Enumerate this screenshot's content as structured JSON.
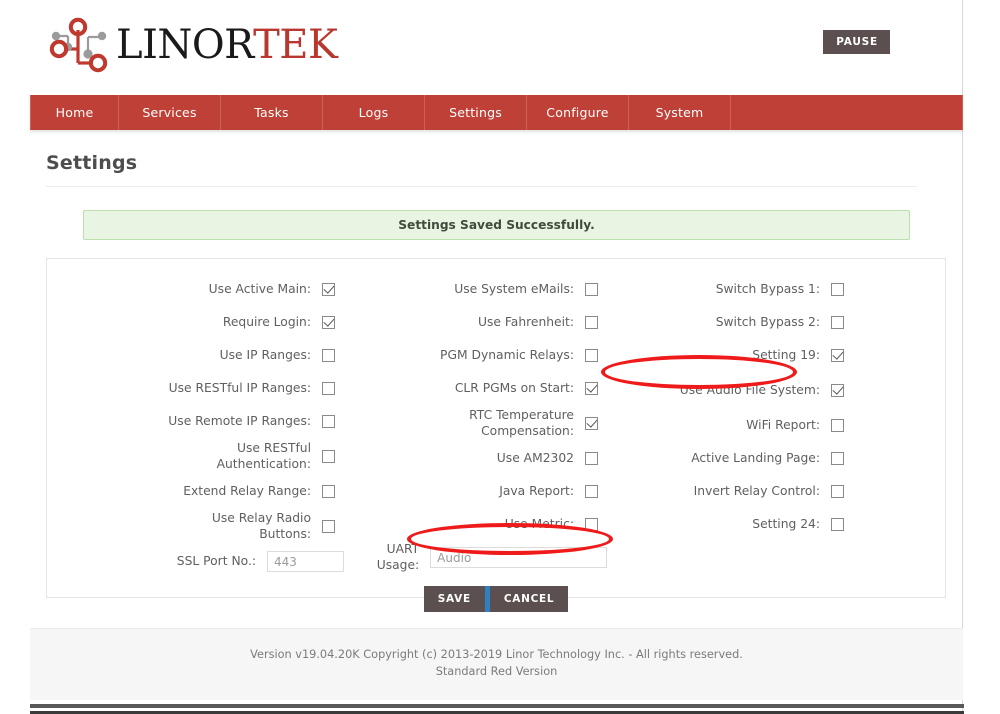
{
  "brand": {
    "name_part1": "LINOR",
    "name_part2": "TEK",
    "logo_icon": "circuit-node-logo",
    "accent_color": "#b8372f"
  },
  "header": {
    "pause_button": "PAUSE"
  },
  "nav": {
    "items": [
      {
        "label": "Home"
      },
      {
        "label": "Services"
      },
      {
        "label": "Tasks"
      },
      {
        "label": "Logs"
      },
      {
        "label": "Settings"
      },
      {
        "label": "Configure"
      },
      {
        "label": "System"
      }
    ]
  },
  "page": {
    "title": "Settings",
    "alert": "Settings Saved Successfully."
  },
  "settings": {
    "column1": [
      {
        "label": "Use Active Main:",
        "type": "checkbox",
        "checked": true
      },
      {
        "label": "Require Login:",
        "type": "checkbox",
        "checked": true
      },
      {
        "label": "Use IP Ranges:",
        "type": "checkbox",
        "checked": false
      },
      {
        "label": "Use RESTful IP Ranges:",
        "type": "checkbox",
        "checked": false
      },
      {
        "label": "Use Remote IP Ranges:",
        "type": "checkbox",
        "checked": false
      },
      {
        "label": "Use RESTful\nAuthentication:",
        "type": "checkbox",
        "checked": false
      },
      {
        "label": "Extend Relay Range:",
        "type": "checkbox",
        "checked": false
      },
      {
        "label": "Use Relay Radio\nButtons:",
        "type": "checkbox",
        "checked": false
      },
      {
        "label": "SSL Port No.:",
        "type": "text",
        "value": "443"
      }
    ],
    "column2": [
      {
        "label": "Use System eMails:",
        "type": "checkbox",
        "checked": false
      },
      {
        "label": "Use Fahrenheit:",
        "type": "checkbox",
        "checked": false
      },
      {
        "label": "PGM Dynamic Relays:",
        "type": "checkbox",
        "checked": false
      },
      {
        "label": "CLR PGMs on Start:",
        "type": "checkbox",
        "checked": true
      },
      {
        "label": "RTC Temperature\nCompensation:",
        "type": "checkbox",
        "checked": true
      },
      {
        "label": "Use AM2302",
        "type": "checkbox",
        "checked": false
      },
      {
        "label": "Java Report:",
        "type": "checkbox",
        "checked": false
      },
      {
        "label": "Use Metric:",
        "type": "checkbox",
        "checked": false
      },
      {
        "label": "UART Usage:",
        "type": "text",
        "value": "Audio"
      }
    ],
    "column3": [
      {
        "label": "Switch Bypass 1:",
        "type": "checkbox",
        "checked": false
      },
      {
        "label": "Switch Bypass 2:",
        "type": "checkbox",
        "checked": false
      },
      {
        "label": "Setting 19:",
        "type": "checkbox",
        "checked": true
      },
      {
        "label": "Use Audio File System:",
        "type": "checkbox",
        "checked": true
      },
      {
        "label": "WiFi Report:",
        "type": "checkbox",
        "checked": false
      },
      {
        "label": "Active Landing Page:",
        "type": "checkbox",
        "checked": false
      },
      {
        "label": "Invert Relay Control:",
        "type": "checkbox",
        "checked": false
      },
      {
        "label": "Setting 24:",
        "type": "checkbox",
        "checked": false
      }
    ],
    "save_label": "SAVE",
    "cancel_label": "CANCEL"
  },
  "footer": {
    "line1": "Version v19.04.20K Copyright (c) 2013-2019 Linor Technology Inc. - All rights reserved.",
    "line2": "Standard Red Version"
  },
  "annotations": [
    {
      "name": "use-audio-file-system-highlight",
      "color": "#ef1b1b"
    },
    {
      "name": "uart-usage-highlight",
      "color": "#ef1b1b"
    }
  ]
}
